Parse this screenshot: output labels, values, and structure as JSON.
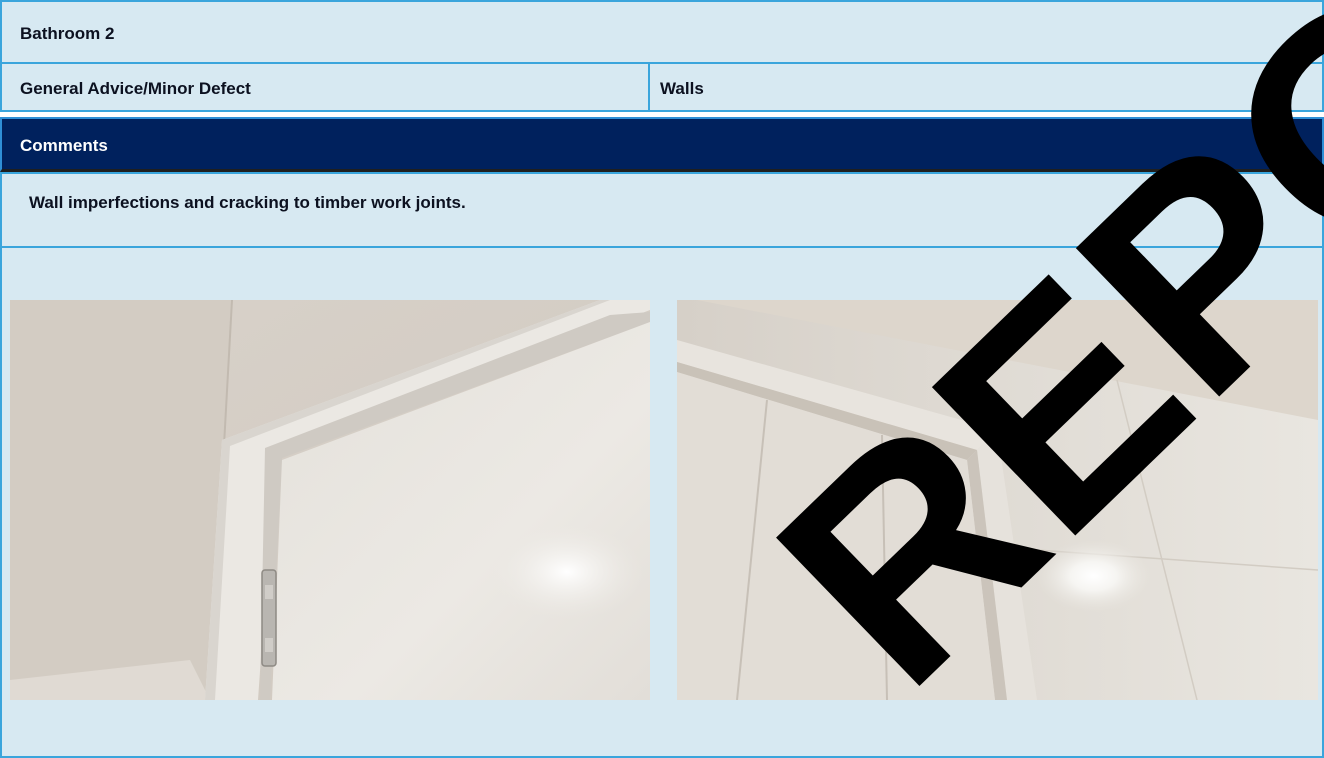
{
  "section": {
    "title": "Bathroom 2",
    "category": "General Advice/Minor Defect",
    "location": "Walls"
  },
  "comments": {
    "heading": "Comments",
    "text": "Wall imperfections and cracking to timber work joints."
  },
  "photos": [
    {
      "subject": "door frame corner with hinge"
    },
    {
      "subject": "door frame corner with light glare"
    }
  ],
  "watermark": {
    "text": "REPORT"
  },
  "colors": {
    "cell_background": "#d7e9f2",
    "cell_border": "#3aa5dc",
    "header_background": "#00215d",
    "header_text": "#ffffff"
  }
}
